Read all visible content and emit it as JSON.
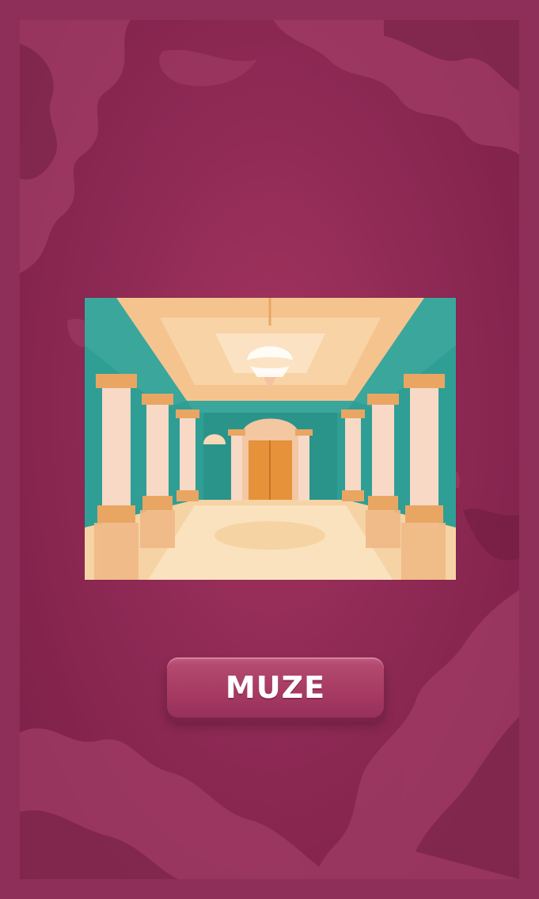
{
  "screen": {
    "scene_image": "ballroom-hall",
    "play_button_label": "MUZE"
  },
  "colors": {
    "frame": "#8e2f5a",
    "background": "#93295a",
    "blob": "#a03c66",
    "blob_dark": "#6f1b40",
    "button": "#a63a62",
    "wall": "#2f9e95",
    "ceiling": "#f5c48e"
  }
}
